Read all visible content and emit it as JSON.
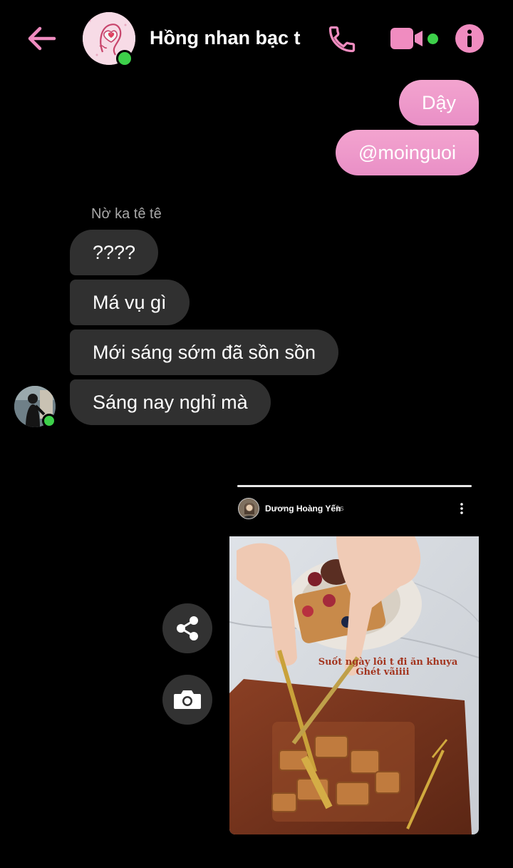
{
  "header": {
    "title": "Hồng nhan bạc t",
    "colors": {
      "accent": "#f08cc0",
      "online": "#3dd04a"
    }
  },
  "messages_out": [
    {
      "text": "Dậy"
    },
    {
      "text": "@moinguoi"
    }
  ],
  "incoming": {
    "sender_name": "Nờ ka tê tê",
    "messages": [
      {
        "text": "????"
      },
      {
        "text": "Má vụ gì"
      },
      {
        "text": "Mới sáng sớm đã sồn sồn"
      },
      {
        "text": "Sáng nay nghỉ mà"
      }
    ]
  },
  "story": {
    "author": "Dương Hoàng Yến",
    "time": "1s",
    "caption_line1": "Suốt ngày lôi t đi ăn khuya",
    "caption_line2": "Ghét vãiiii",
    "progress": 1.0
  },
  "icons": {
    "back": "arrow-left-icon",
    "call": "phone-icon",
    "video": "video-camera-icon",
    "info": "info-icon",
    "share": "share-icon",
    "camera": "camera-icon",
    "menu": "more-vertical-icon"
  }
}
